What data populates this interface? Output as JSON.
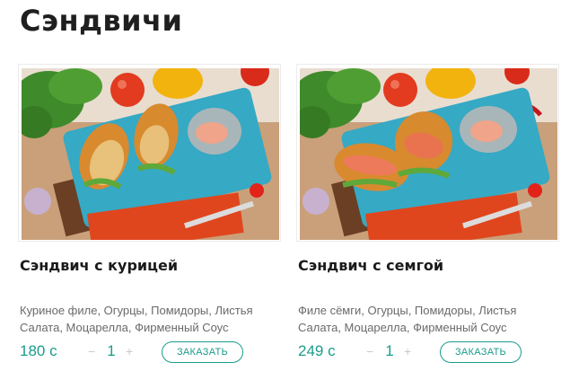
{
  "page": {
    "title": "Сэндвичи"
  },
  "products": [
    {
      "title": "Сэндвич с курицей",
      "description": "Куриное филе, Огурцы, Помидоры, Листья Салата, Моцарелла, Фирменный Соус",
      "price": "180 с",
      "quantity": "1",
      "minus": "−",
      "plus": "+",
      "order_label": "ЗАКАЗАТЬ"
    },
    {
      "title": "Сэндвич с семгой",
      "description": "Филе сёмги, Огурцы, Помидоры, Листья Салата, Моцарелла, Фирменный Соус",
      "price": "249 с",
      "quantity": "1",
      "minus": "−",
      "plus": "+",
      "order_label": "ЗАКАЗАТЬ"
    }
  ],
  "colors": {
    "accent": "#1b9c8c",
    "title": "#1f1f1f",
    "description": "#6a6a6a"
  }
}
